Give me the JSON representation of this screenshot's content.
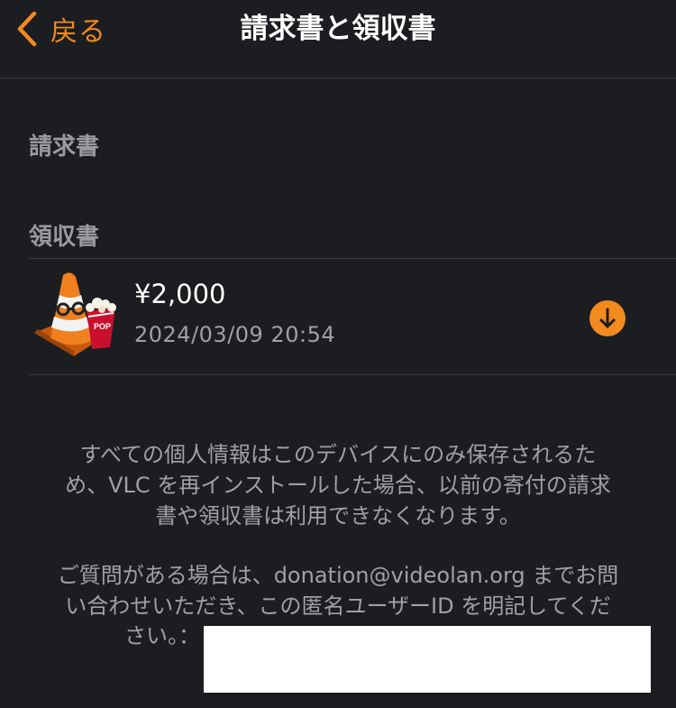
{
  "nav": {
    "back_label": "戻る",
    "title": "請求書と領収書"
  },
  "sections": {
    "invoices_header": "請求書",
    "receipts_header": "領収書"
  },
  "receipt": {
    "amount": "¥2,000",
    "date": "2024/03/09 20:54",
    "icon": "vlc-cone-popcorn-icon"
  },
  "footer": {
    "line1": "すべての個人情報はこのデバイスにのみ保存されるた",
    "line2": "め、VLC を再インストールした場合、以前の寄付の請求",
    "line3": "書や領収書は利用できなくなります。",
    "line4": "ご質問がある場合は、donation@videolan.org までお問",
    "line5": "い合わせいただき、この匿名ユーザーID を明記してくだ",
    "line6": "さい。："
  },
  "colors": {
    "accent": "#f28a1e",
    "background": "#1c1d20",
    "secondary_text": "#a0a0a5"
  }
}
